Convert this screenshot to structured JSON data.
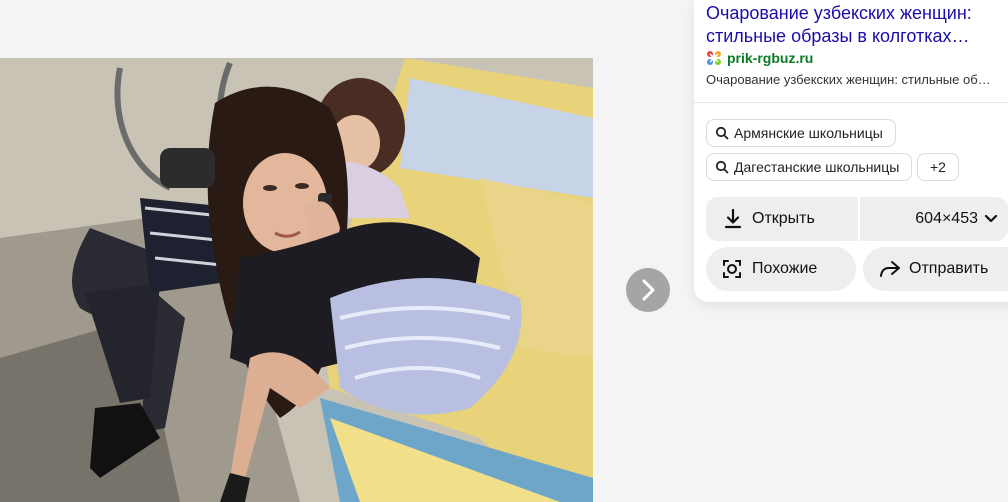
{
  "viewer": {
    "image_alt": "Photo: girl sitting on a bench talking on the phone",
    "next_icon": "chevron-right-icon"
  },
  "panel": {
    "title": "Очарование узбекских женщин:\nстильные образы в колготках…",
    "source_name": "prik-rgbuz.ru",
    "source_icon": "site-favicon-icon",
    "snippet": "Очарование узбекских женщин: стильные об…",
    "chips": [
      {
        "label": "Армянские школьницы",
        "icon": "search-icon"
      },
      {
        "label": "Дагестанские школьницы",
        "icon": "search-icon"
      },
      {
        "label": "+2"
      }
    ],
    "open_label": "Открыть",
    "open_icon": "download-icon",
    "size_label": "604×453",
    "size_icon": "chevron-down-icon",
    "similar_label": "Похожие",
    "similar_icon": "lens-search-icon",
    "share_label": "Отправить",
    "share_icon": "share-arrow-icon"
  }
}
